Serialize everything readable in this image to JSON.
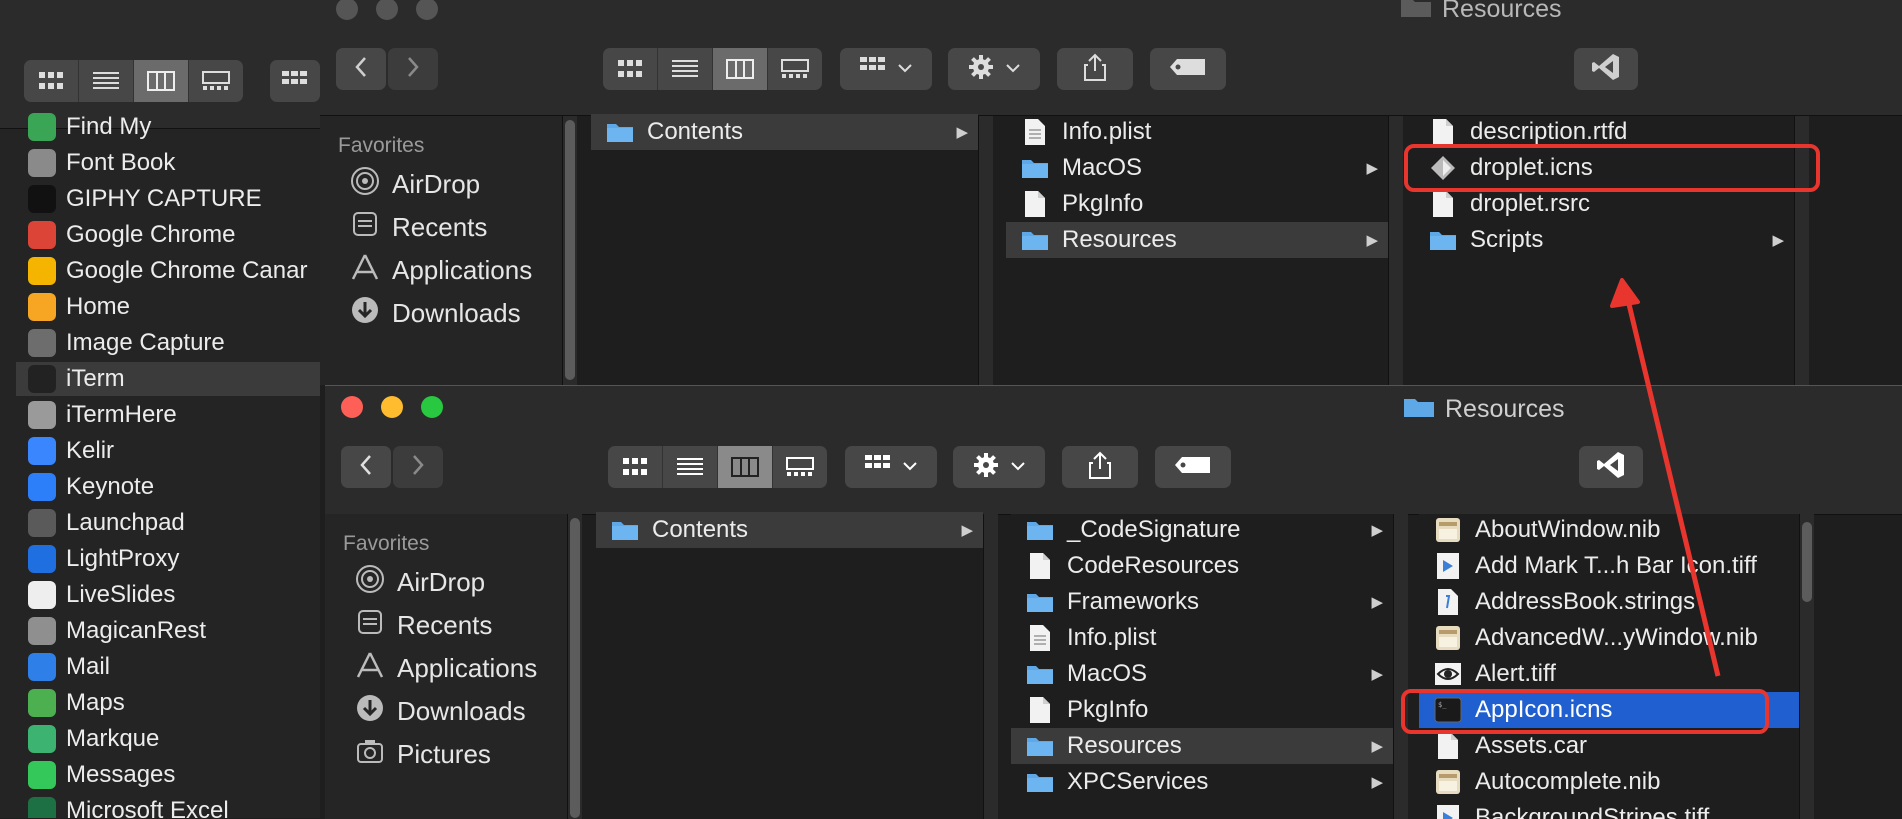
{
  "left_app_list": {
    "items": [
      {
        "label": "Find My",
        "icon": "find-my-icon",
        "color": "#3aa655"
      },
      {
        "label": "Font Book",
        "icon": "font-book-icon",
        "color": "#8a8a8a"
      },
      {
        "label": "GIPHY CAPTURE",
        "icon": "giphy-capture-icon",
        "color": "#111111"
      },
      {
        "label": "Google Chrome",
        "icon": "google-chrome-icon",
        "color": "#db4437"
      },
      {
        "label": "Google Chrome Canar",
        "icon": "google-chrome-canary-icon",
        "color": "#f4b400"
      },
      {
        "label": "Home",
        "icon": "home-icon",
        "color": "#f6a623"
      },
      {
        "label": "Image Capture",
        "icon": "image-capture-icon",
        "color": "#6d6d6d"
      },
      {
        "label": "iTerm",
        "icon": "iterm-icon",
        "color": "#222222"
      },
      {
        "label": "iTermHere",
        "icon": "itermhere-icon",
        "color": "#9a9a9a"
      },
      {
        "label": "Kelir",
        "icon": "kelir-icon",
        "color": "#3a86ff"
      },
      {
        "label": "Keynote",
        "icon": "keynote-icon",
        "color": "#2d7ff9"
      },
      {
        "label": "Launchpad",
        "icon": "launchpad-icon",
        "color": "#5a5a5a"
      },
      {
        "label": "LightProxy",
        "icon": "lightproxy-icon",
        "color": "#1f6fe0"
      },
      {
        "label": "LiveSlides",
        "icon": "liveslides-icon",
        "color": "#eeeeee"
      },
      {
        "label": "MagicanRest",
        "icon": "magicanrest-icon",
        "color": "#8f8f8f"
      },
      {
        "label": "Mail",
        "icon": "mail-icon",
        "color": "#2f7fe8"
      },
      {
        "label": "Maps",
        "icon": "maps-icon",
        "color": "#4caf50"
      },
      {
        "label": "Markque",
        "icon": "markque-icon",
        "color": "#3cb371"
      },
      {
        "label": "Messages",
        "icon": "messages-icon",
        "color": "#34c759"
      },
      {
        "label": "Microsoft Excel",
        "icon": "microsoft-excel-icon",
        "color": "#1d7044"
      }
    ],
    "selected": "iTerm"
  },
  "back_window": {
    "title": "Resources",
    "favorites_heading": "Favorites",
    "favorites": [
      "AirDrop",
      "Recents",
      "Applications",
      "Downloads"
    ],
    "col1": [
      "Contents"
    ],
    "col2": [
      "Info.plist",
      "MacOS",
      "PkgInfo",
      "Resources"
    ],
    "col3": [
      "description.rtfd",
      "droplet.icns",
      "droplet.rsrc",
      "Scripts"
    ]
  },
  "front_window": {
    "title": "Resources",
    "favorites_heading": "Favorites",
    "favorites": [
      "AirDrop",
      "Recents",
      "Applications",
      "Downloads",
      "Pictures"
    ],
    "col1": [
      "Contents"
    ],
    "col2": [
      "_CodeSignature",
      "CodeResources",
      "Frameworks",
      "Info.plist",
      "MacOS",
      "PkgInfo",
      "Resources",
      "XPCServices"
    ],
    "col3": [
      "AboutWindow.nib",
      "Add Mark T...h Bar Icon.tiff",
      "AddressBook.strings",
      "AdvancedW...yWindow.nib",
      "Alert.tiff",
      "AppIcon.icns",
      "Assets.car",
      "Autocomplete.nib",
      "BackgroundStripes.tiff"
    ]
  },
  "colors": {
    "accent_selection": "#1f5fcf",
    "annotation_red": "#e8352e",
    "folder_blue": "#5fa8e8"
  }
}
